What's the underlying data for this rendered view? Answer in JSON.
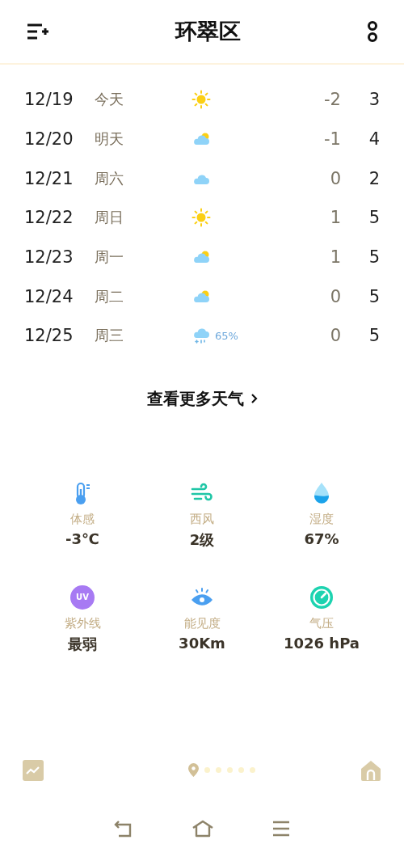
{
  "header": {
    "title": "环翠区"
  },
  "forecast": [
    {
      "date": "12/19",
      "day": "今天",
      "kind": "sunny",
      "low": "-2",
      "high": "3"
    },
    {
      "date": "12/20",
      "day": "明天",
      "kind": "partly-cloudy",
      "low": "-1",
      "high": "4"
    },
    {
      "date": "12/21",
      "day": "周六",
      "kind": "cloudy",
      "low": "0",
      "high": "2"
    },
    {
      "date": "12/22",
      "day": "周日",
      "kind": "sunny",
      "low": "1",
      "high": "5"
    },
    {
      "date": "12/23",
      "day": "周一",
      "kind": "partly-cloudy",
      "low": "1",
      "high": "5"
    },
    {
      "date": "12/24",
      "day": "周二",
      "kind": "partly-cloudy",
      "low": "0",
      "high": "5"
    },
    {
      "date": "12/25",
      "day": "周三",
      "kind": "sleet",
      "precip": "65%",
      "low": "0",
      "high": "5"
    }
  ],
  "more_link": {
    "label": "查看更多天气"
  },
  "details": [
    {
      "kind": "thermometer",
      "label": "体感",
      "value": "-3℃"
    },
    {
      "kind": "wind",
      "label": "西风",
      "value": "2级"
    },
    {
      "kind": "drop",
      "label": "湿度",
      "value": "67%"
    },
    {
      "kind": "uv",
      "badge": "UV",
      "label": "紫外线",
      "value": "最弱"
    },
    {
      "kind": "eye",
      "label": "能见度",
      "value": "30Km"
    },
    {
      "kind": "gauge",
      "label": "气压",
      "value": "1026 hPa"
    }
  ],
  "pages": [
    {
      "kind": "location",
      "selected": true
    },
    {
      "kind": "dot",
      "selected": false
    },
    {
      "kind": "dot",
      "selected": false
    },
    {
      "kind": "dot",
      "selected": false
    },
    {
      "kind": "dot",
      "selected": false
    },
    {
      "kind": "dot",
      "selected": false
    }
  ]
}
